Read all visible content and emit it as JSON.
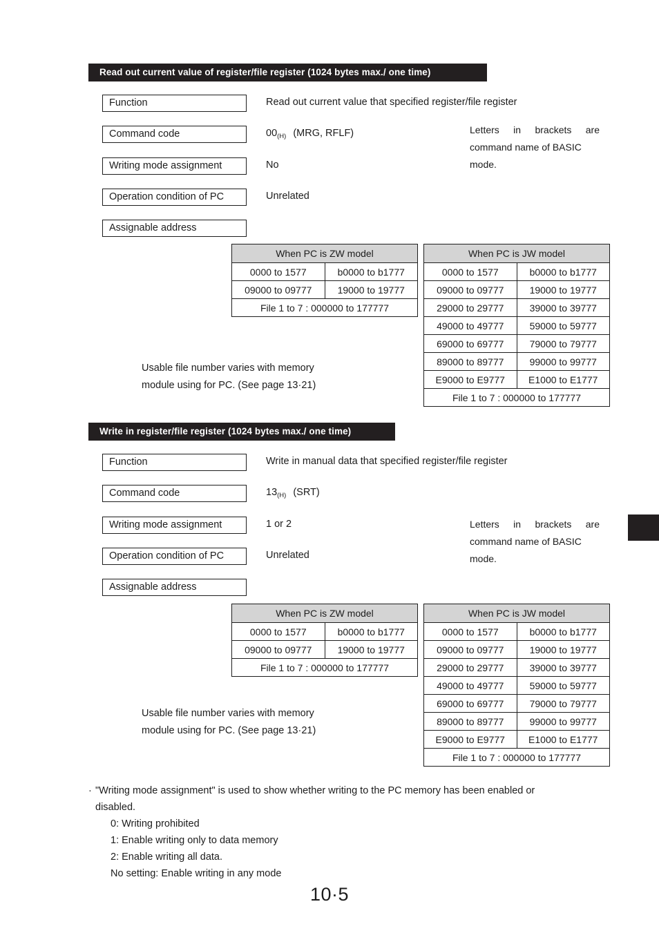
{
  "page": {
    "number": "10·5"
  },
  "sections": [
    {
      "header": "Read out current value of register/file register (1024 bytes max./ one time)",
      "fields": [
        {
          "label": "Function",
          "value": "Read out current value that specified register/file register"
        },
        {
          "label": "Command code",
          "value_main": "00",
          "value_sub": "(H)",
          "value_rest": "(MRG, RFLF)"
        },
        {
          "label": "Writing mode assignment",
          "value": "No"
        },
        {
          "label": "Operation condition of PC",
          "value": "Unrelated"
        },
        {
          "label": "Assignable address",
          "value": ""
        }
      ],
      "side_note": [
        "Letters in brackets are",
        "command name of BASIC",
        "mode."
      ],
      "file_note": [
        "Usable file number varies with memory",
        "module using for PC. (See page 13·21)"
      ],
      "zw_table": {
        "header": "When PC is ZW model",
        "rows": [
          [
            "0000 to  1577",
            "b0000 to b1777"
          ],
          [
            "09000 to 09777",
            "19000 to 19777"
          ]
        ],
        "footer": "File 1 to 7 : 000000 to 177777"
      },
      "jw_table": {
        "header": "When PC is JW model",
        "rows": [
          [
            "0000 to  1577",
            "b0000 to b1777"
          ],
          [
            "09000 to 09777",
            "19000 to 19777"
          ],
          [
            "29000 to 29777",
            "39000 to 39777"
          ],
          [
            "49000 to 49777",
            "59000 to 59777"
          ],
          [
            "69000 to 69777",
            "79000 to 79777"
          ],
          [
            "89000 to 89777",
            "99000 to 99777"
          ],
          [
            "E9000 to E9777",
            "E1000 to E1777"
          ]
        ],
        "footer": "File 1 to 7 : 000000 to 177777"
      }
    },
    {
      "header": "Write in register/file register (1024 bytes max./ one time)",
      "fields": [
        {
          "label": "Function",
          "value": "Write in manual data that specified register/file register"
        },
        {
          "label": "Command code",
          "value_main": "13",
          "value_sub": "(H)",
          "value_rest": "(SRT)"
        },
        {
          "label": "Writing mode assignment",
          "value": "1 or 2"
        },
        {
          "label": "Operation condition of PC",
          "value": "Unrelated"
        },
        {
          "label": "Assignable address",
          "value": ""
        }
      ],
      "side_note": [
        "Letters in brackets are",
        "command name of BASIC",
        "mode."
      ],
      "file_note": [
        "Usable file number varies with memory",
        "module using for PC. (See page 13·21)"
      ],
      "zw_table": {
        "header": "When PC is ZW model",
        "rows": [
          [
            "0000 to  1577",
            "b0000 to b1777"
          ],
          [
            "09000 to 09777",
            "19000 to 19777"
          ]
        ],
        "footer": "File 1 to 7 : 000000 to 177777"
      },
      "jw_table": {
        "header": "When PC is JW model",
        "rows": [
          [
            "0000 to  1577",
            "b0000 to b1777"
          ],
          [
            "09000 to 09777",
            "19000 to 19777"
          ],
          [
            "29000 to 29777",
            "39000 to 39777"
          ],
          [
            "49000 to 49777",
            "59000 to 59777"
          ],
          [
            "69000 to 69777",
            "79000 to 79777"
          ],
          [
            "89000 to 89777",
            "99000 to 99777"
          ],
          [
            "E9000 to E9777",
            "E1000 to E1777"
          ]
        ],
        "footer": "File 1 to 7 : 000000 to 177777"
      }
    }
  ],
  "footnote": {
    "lead": "\"Writing mode assignment\" is used to show whether writing to the PC memory has been enabled or",
    "lead_cont": "disabled.",
    "items": [
      "0: Writing prohibited",
      "1: Enable writing only to data memory",
      "2: Enable writing all data.",
      "No setting: Enable writing in any mode"
    ]
  }
}
